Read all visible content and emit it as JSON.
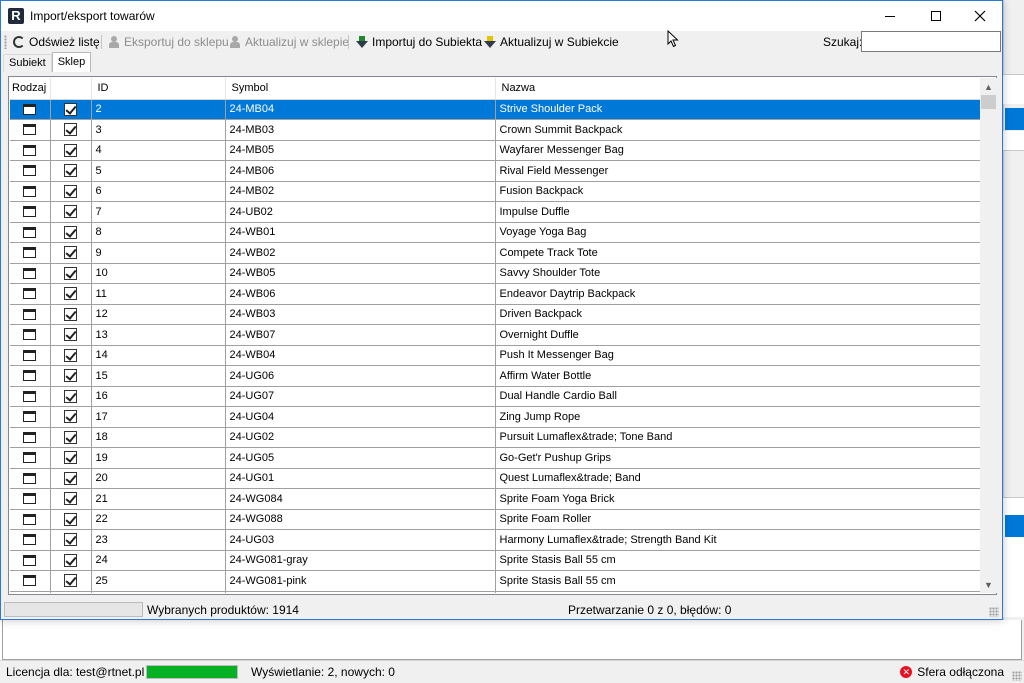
{
  "window": {
    "title": "Import/eksport towarów",
    "logo_letter": "R"
  },
  "toolbar": {
    "refresh_label": "Odśwież listę",
    "export_label": "Eksportuj do sklepu",
    "update_shop_label": "Aktualizuj w sklepie",
    "import_label": "Importuj do Subiekta",
    "update_subiekt_label": "Aktualizuj w Subiekcie",
    "search_label": "Szukaj:",
    "search_value": ""
  },
  "tabs": [
    {
      "label": "Subiekt",
      "active": false
    },
    {
      "label": "Sklep",
      "active": true
    }
  ],
  "grid": {
    "columns": [
      "Rodzaj",
      "",
      "ID",
      "Symbol",
      "Nazwa"
    ],
    "rows": [
      {
        "checked": true,
        "id": "2",
        "symbol": "24-MB04",
        "name": "Strive Shoulder Pack",
        "selected": true
      },
      {
        "checked": true,
        "id": "3",
        "symbol": "24-MB03",
        "name": "Crown Summit Backpack"
      },
      {
        "checked": true,
        "id": "4",
        "symbol": "24-MB05",
        "name": "Wayfarer Messenger Bag"
      },
      {
        "checked": true,
        "id": "5",
        "symbol": "24-MB06",
        "name": "Rival Field Messenger"
      },
      {
        "checked": true,
        "id": "6",
        "symbol": "24-MB02",
        "name": "Fusion Backpack"
      },
      {
        "checked": true,
        "id": "7",
        "symbol": "24-UB02",
        "name": "Impulse Duffle"
      },
      {
        "checked": true,
        "id": "8",
        "symbol": "24-WB01",
        "name": "Voyage Yoga Bag"
      },
      {
        "checked": true,
        "id": "9",
        "symbol": "24-WB02",
        "name": "Compete Track Tote"
      },
      {
        "checked": true,
        "id": "10",
        "symbol": "24-WB05",
        "name": "Savvy Shoulder Tote"
      },
      {
        "checked": true,
        "id": "11",
        "symbol": "24-WB06",
        "name": "Endeavor Daytrip Backpack"
      },
      {
        "checked": true,
        "id": "12",
        "symbol": "24-WB03",
        "name": "Driven Backpack"
      },
      {
        "checked": true,
        "id": "13",
        "symbol": "24-WB07",
        "name": "Overnight Duffle"
      },
      {
        "checked": true,
        "id": "14",
        "symbol": "24-WB04",
        "name": "Push It Messenger Bag"
      },
      {
        "checked": true,
        "id": "15",
        "symbol": "24-UG06",
        "name": "Affirm Water Bottle"
      },
      {
        "checked": true,
        "id": "16",
        "symbol": "24-UG07",
        "name": "Dual Handle Cardio Ball"
      },
      {
        "checked": true,
        "id": "17",
        "symbol": "24-UG04",
        "name": "Zing Jump Rope"
      },
      {
        "checked": true,
        "id": "18",
        "symbol": "24-UG02",
        "name": "Pursuit Lumaflex&trade; Tone Band"
      },
      {
        "checked": true,
        "id": "19",
        "symbol": "24-UG05",
        "name": "Go-Get'r Pushup Grips"
      },
      {
        "checked": true,
        "id": "20",
        "symbol": "24-UG01",
        "name": "Quest Lumaflex&trade; Band"
      },
      {
        "checked": true,
        "id": "21",
        "symbol": "24-WG084",
        "name": "Sprite Foam Yoga Brick"
      },
      {
        "checked": true,
        "id": "22",
        "symbol": "24-WG088",
        "name": "Sprite Foam Roller"
      },
      {
        "checked": true,
        "id": "23",
        "symbol": "24-UG03",
        "name": "Harmony Lumaflex&trade; Strength Band Kit"
      },
      {
        "checked": true,
        "id": "24",
        "symbol": "24-WG081-gray",
        "name": "Sprite Stasis Ball 55 cm"
      },
      {
        "checked": true,
        "id": "25",
        "symbol": "24-WG081-pink",
        "name": "Sprite Stasis Ball 55 cm"
      },
      {
        "checked": true,
        "id": "",
        "symbol": "",
        "name": ""
      }
    ]
  },
  "dialog_status": {
    "selected_text": "Wybranych produktów: 1914",
    "processing_text": "Przetwarzanie 0 z 0, błędów: 0"
  },
  "app_status": {
    "license_text": "Licencja dla: test@rtnet.pl",
    "progress_fraction": 1.0,
    "display_text": "Wyświetlanie: 2, nowych: 0",
    "sphere_text": "Sfera odłączona"
  },
  "colors": {
    "selection": "#0078d7",
    "progress_green": "#06b025",
    "error_red": "#e81123"
  }
}
